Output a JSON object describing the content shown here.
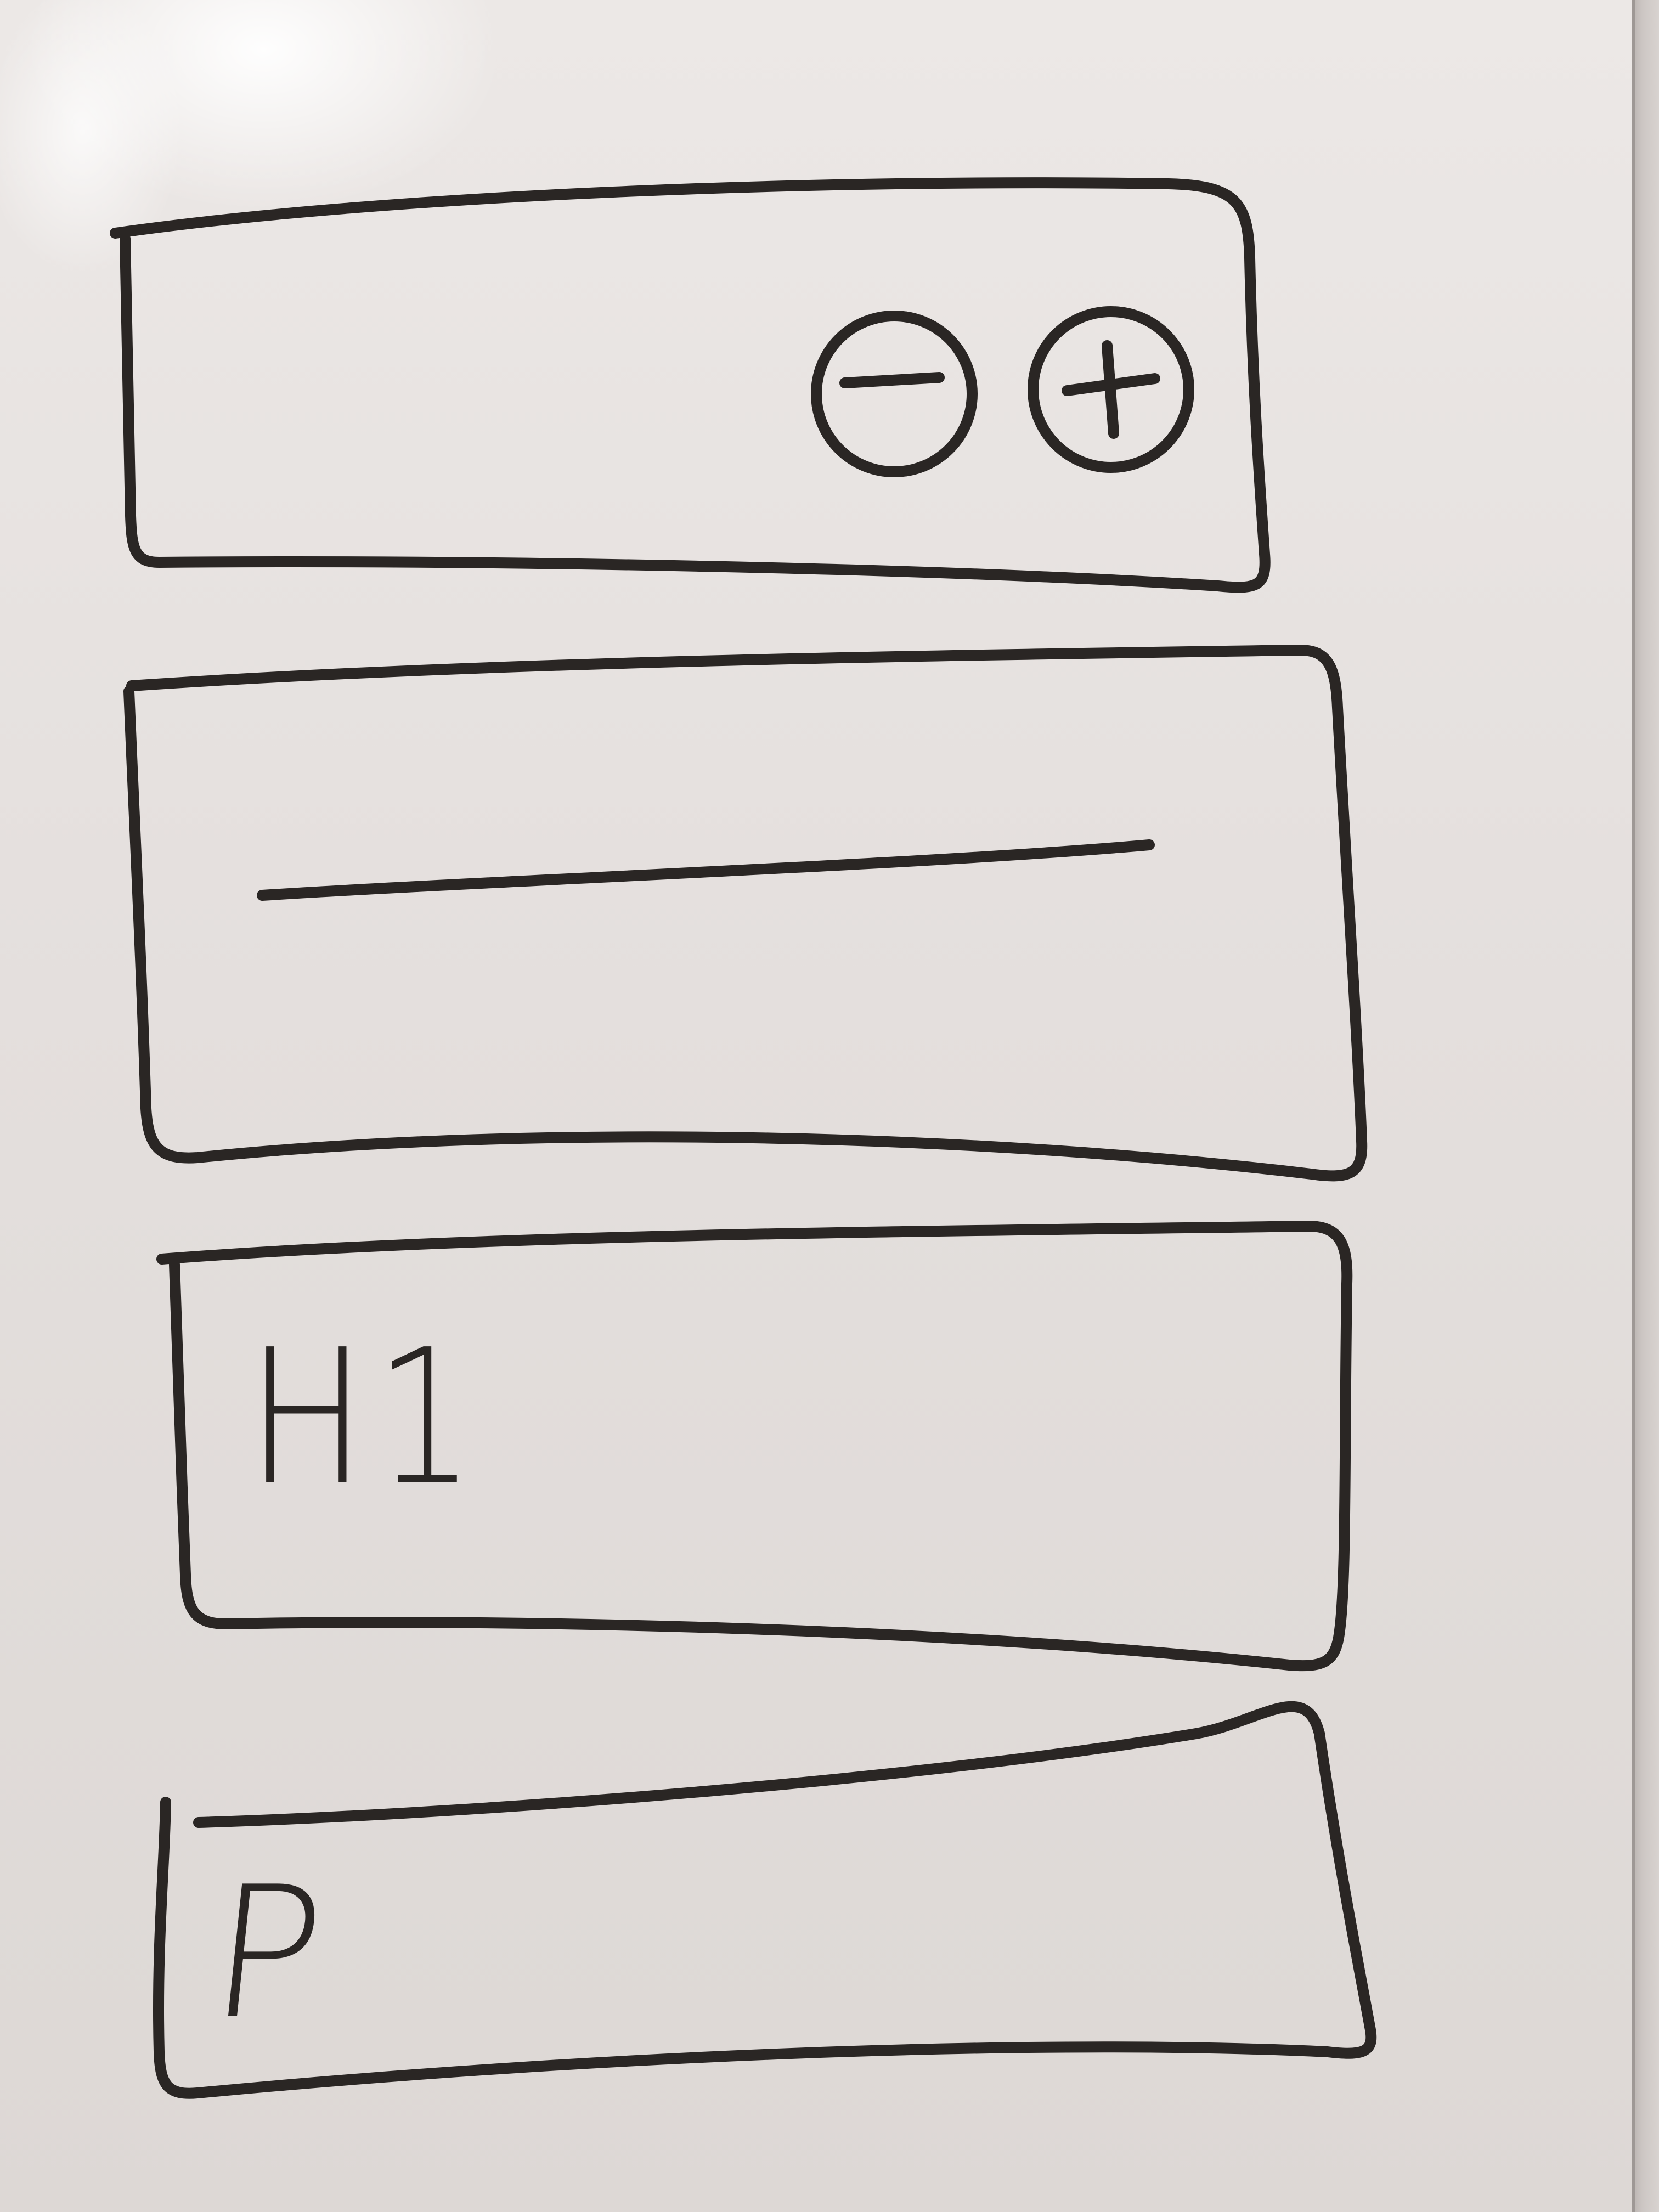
{
  "sketch": {
    "ink_color": "#2a2624",
    "board_color": "#e6e1df",
    "panels": [
      {
        "role": "toolbar",
        "controls": [
          {
            "icon": "minus-circle-icon"
          },
          {
            "icon": "plus-circle-icon"
          }
        ]
      },
      {
        "role": "input",
        "content": "horizontal-line"
      },
      {
        "role": "heading",
        "label": "H1"
      },
      {
        "role": "paragraph",
        "label": "P"
      }
    ]
  }
}
